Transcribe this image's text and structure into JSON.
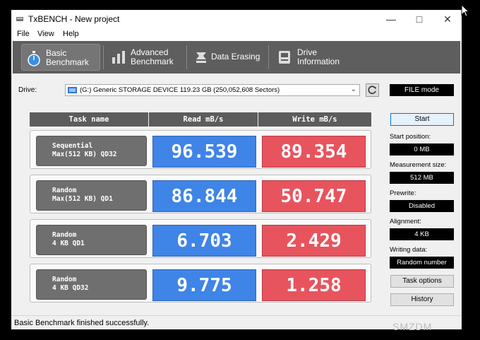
{
  "window": {
    "title": "TxBENCH - New project"
  },
  "menu": [
    "File",
    "View",
    "Help"
  ],
  "tabs": [
    {
      "line1": "Basic",
      "line2": "Benchmark",
      "icon": "stopwatch-icon",
      "active": true
    },
    {
      "line1": "Advanced",
      "line2": "Benchmark",
      "icon": "bar-chart-icon",
      "active": false
    },
    {
      "line1": "Data Erasing",
      "line2": "",
      "icon": "erase-icon",
      "active": false
    },
    {
      "line1": "Drive",
      "line2": "Information",
      "icon": "drive-info-icon",
      "active": false
    }
  ],
  "drive": {
    "label": "Drive:",
    "selected": "(G:) Generic STORAGE DEVICE  119.23 GB (250,052,608 Sectors)",
    "mode": "FILE mode"
  },
  "table": {
    "headers": [
      "Task name",
      "Read mB/s",
      "Write mB/s"
    ],
    "rows": [
      {
        "line1": "Sequential",
        "line2": "Max(512 KB) QD32",
        "read": "96.539",
        "write": "89.354"
      },
      {
        "line1": "Random",
        "line2": "Max(512 KB) QD1",
        "read": "86.844",
        "write": "50.747"
      },
      {
        "line1": "Random",
        "line2": "4 KB QD1",
        "read": "6.703",
        "write": "2.429"
      },
      {
        "line1": "Random",
        "line2": "4 KB QD32",
        "read": "9.775",
        "write": "1.258"
      }
    ]
  },
  "side": {
    "start": "Start",
    "start_position_label": "Start position:",
    "start_position": "0 MB",
    "measurement_label": "Measurement size:",
    "measurement": "512 MB",
    "prewrite_label": "Prewrite:",
    "prewrite": "Disabled",
    "alignment_label": "Alignment:",
    "alignment": "4 KB",
    "writing_label": "Writing data:",
    "writing": "Random number",
    "task_options": "Task options",
    "history": "History"
  },
  "status": "Basic Benchmark finished successfully.",
  "watermark": "SMZDM",
  "colors": {
    "read": "#3f84e7",
    "write": "#e8545e",
    "tabbar": "#5e5e5e"
  }
}
